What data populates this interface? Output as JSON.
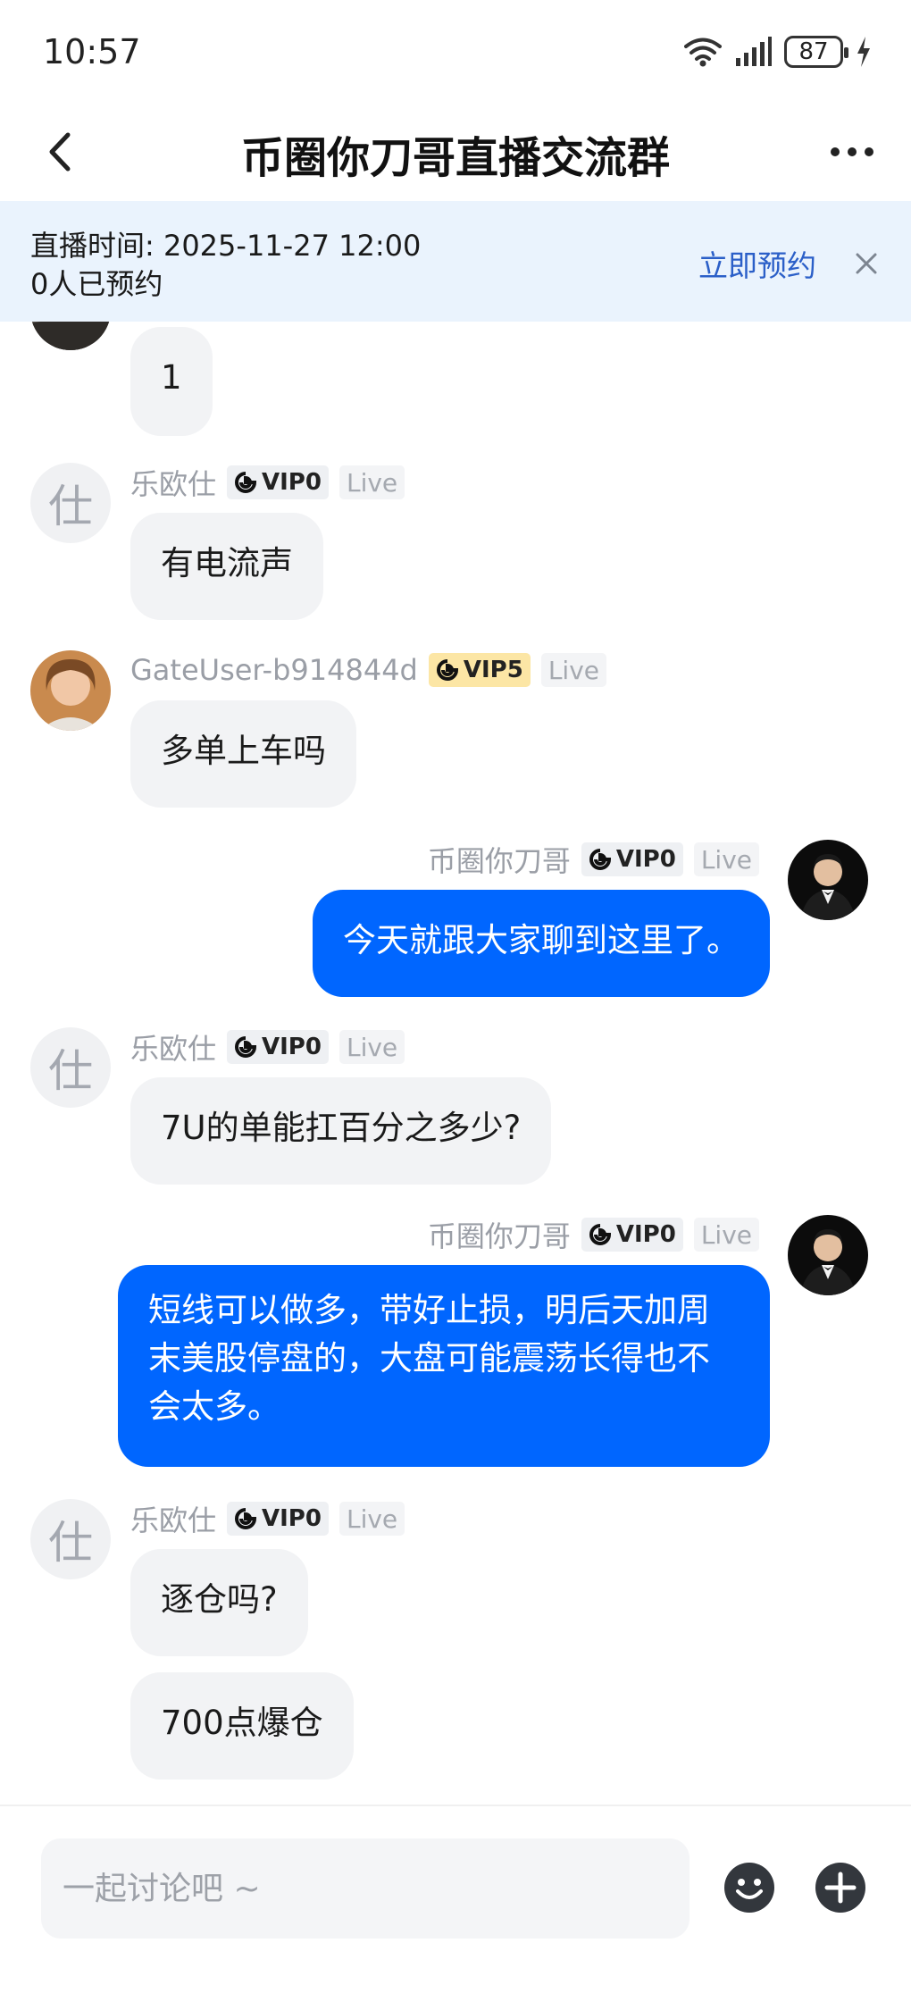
{
  "status_bar": {
    "time": "10:57",
    "battery": "87"
  },
  "header": {
    "title": "币圈你刀哥直播交流群"
  },
  "banner": {
    "live_time": "直播时间: 2025-11-27 12:00",
    "reserved_count": "0人已预约",
    "reserve_label": "立即预约"
  },
  "messages": [
    {
      "side": "in",
      "text": "1"
    },
    {
      "side": "in",
      "avatar_char": "仕",
      "nick": "乐欧仕",
      "vip": "VIP0",
      "live": "Live",
      "text": "有电流声"
    },
    {
      "side": "in",
      "nick": "GateUser-b914844d",
      "vip": "VIP5",
      "live": "Live",
      "text": "多单上车吗"
    },
    {
      "side": "out",
      "nick": "币圈你刀哥",
      "vip": "VIP0",
      "live": "Live",
      "text": "今天就跟大家聊到这里了。"
    },
    {
      "side": "in",
      "avatar_char": "仕",
      "nick": "乐欧仕",
      "vip": "VIP0",
      "live": "Live",
      "text": "7U的单能扛百分之多少?"
    },
    {
      "side": "out",
      "nick": "币圈你刀哥",
      "vip": "VIP0",
      "live": "Live",
      "text": "短线可以做多，带好止损，明后天加周末美股停盘的，大盘可能震荡长得也不会太多。"
    },
    {
      "side": "in",
      "avatar_char": "仕",
      "nick": "乐欧仕",
      "vip": "VIP0",
      "live": "Live",
      "text": "逐仓吗?"
    },
    {
      "side": "in",
      "text": "700点爆仓"
    }
  ],
  "input": {
    "placeholder": "一起讨论吧 ~",
    "value": ""
  },
  "colors": {
    "accent": "#0066ff",
    "banner_bg": "#eaf3fd",
    "reserve_link": "#2b5fc8",
    "vip_gold": "#fce6a5"
  },
  "icons": [
    "back-arrow-icon",
    "more-icon",
    "close-icon",
    "wifi-icon",
    "signal-icon",
    "battery-icon",
    "charging-icon",
    "vip-logo-icon",
    "emoji-icon",
    "plus-icon"
  ]
}
